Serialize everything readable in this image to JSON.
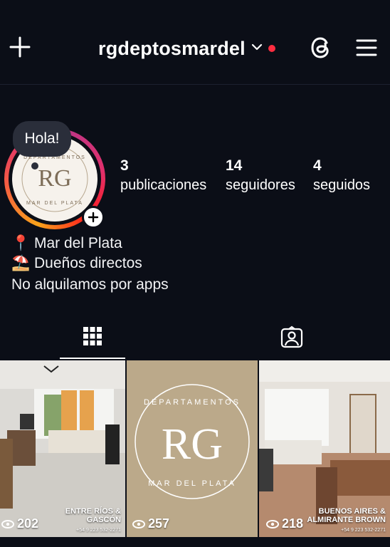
{
  "header": {
    "username": "rgdeptosmardel",
    "icons": [
      "plus-icon",
      "chevron-down-icon",
      "threads-icon",
      "menu-icon"
    ],
    "notification_color": "#ff2d40"
  },
  "profile": {
    "note": "Hola!",
    "stats": [
      {
        "value": "3",
        "label": "publicaciones"
      },
      {
        "value": "14",
        "label": "seguidores"
      },
      {
        "value": "4",
        "label": "seguidos"
      }
    ],
    "bio": [
      {
        "emoji": "📍",
        "text": "Mar del Plata"
      },
      {
        "emoji": "⛱️",
        "text": "Dueños directos"
      },
      {
        "emoji": "",
        "text": "No alquilamos por apps"
      }
    ],
    "logo": {
      "monogram": "RG",
      "top_text": "DEPARTAMENTOS",
      "bottom_text": "MAR DEL PLATA"
    }
  },
  "tabs": [
    "grid-icon",
    "tagged-icon"
  ],
  "posts": [
    {
      "views": "202",
      "location": "ENTRE RÍOS &\nGASCÓN",
      "phone": "+54 9 223 532-2271"
    },
    {
      "views": "257",
      "logo_top": "DEPARTAMENTOS",
      "logo_mono": "RG",
      "logo_bottom": "MAR DEL PLATA"
    },
    {
      "views": "218",
      "location": "BUENOS AIRES &\nALMIRANTE BROWN",
      "phone": "+54 9 223 532-2271"
    }
  ]
}
